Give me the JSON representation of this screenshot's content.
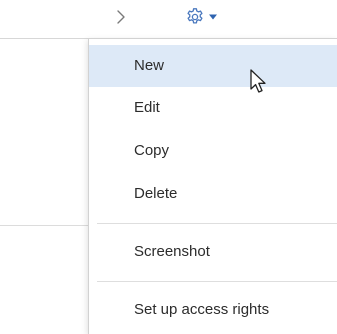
{
  "toolbar": {
    "next_icon": "chevron-right-icon",
    "settings_icon": "gear-icon",
    "dropdown_icon": "caret-down-icon",
    "accent_color": "#3c6fb6"
  },
  "menu": {
    "hover_color": "#dde9f7",
    "items": [
      {
        "label": "New",
        "hovered": true
      },
      {
        "label": "Edit"
      },
      {
        "label": "Copy"
      },
      {
        "label": "Delete"
      },
      {
        "label": "Screenshot"
      },
      {
        "label": "Set up access rights"
      }
    ]
  }
}
